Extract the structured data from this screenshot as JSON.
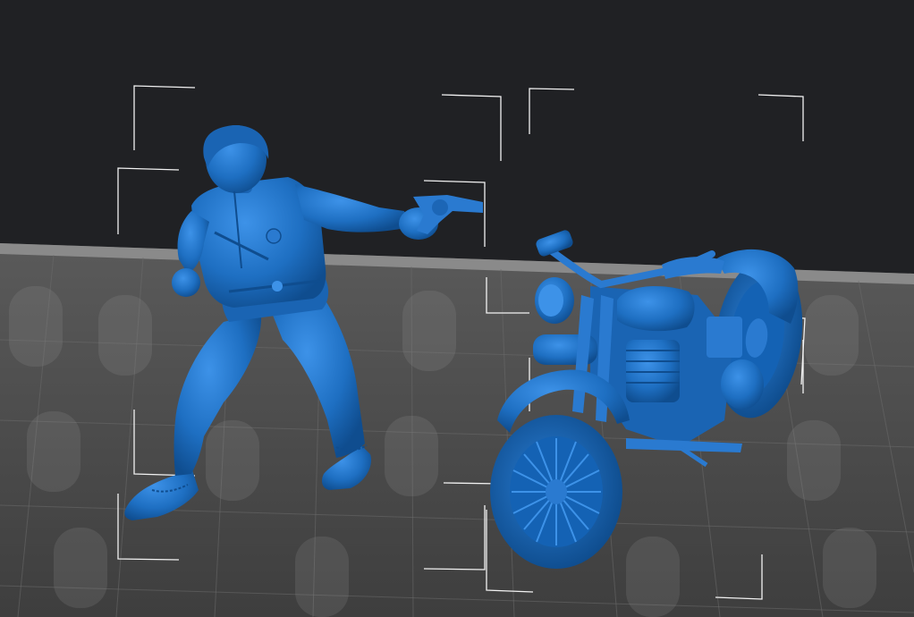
{
  "viewport": {
    "colors": {
      "background": "#202124",
      "build_plate": "#4a4a4a",
      "plate_edge": "#8a8a8a",
      "grid": "#6b6b6b",
      "model": "#1e6fc2",
      "model_highlight": "#3d92e8",
      "model_shadow": "#0f4d8f",
      "bounding_box": "#f2f2f2"
    },
    "models": [
      {
        "name": "gunman-figure",
        "icon": "figure-model"
      },
      {
        "name": "motorcycle",
        "icon": "motorcycle-model"
      }
    ],
    "selection": "both-models-selected"
  }
}
